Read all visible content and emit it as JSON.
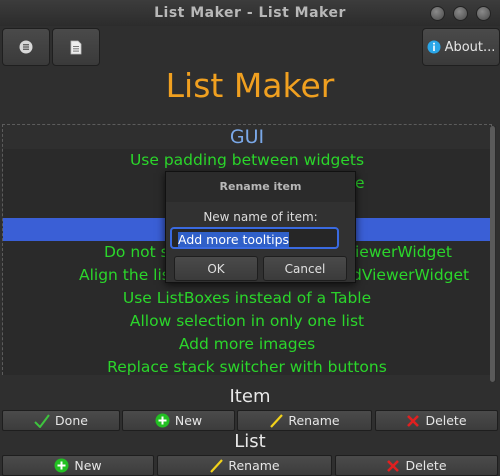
{
  "window": {
    "title": "List Maker - List Maker"
  },
  "toolbar": {
    "about_label": "About..."
  },
  "app_title": "List Maker",
  "list": {
    "header": "GUI",
    "rows": [
      "Use padding between widgets",
      "",
      "",
      "",
      "Do not s",
      "Align the lis",
      "Use ListBoxes instead of a Table",
      "Allow selection in only one list",
      "Add more images",
      "Replace stack switcher with buttons"
    ],
    "row4_right": "iewerWidget",
    "row5_right": "dViewerWidget",
    "row1_right": "e",
    "selected_index": 3
  },
  "dialog": {
    "title": "Rename item",
    "label": "New name of item:",
    "value": "Add more tooltips",
    "ok_label": "OK",
    "cancel_label": "Cancel"
  },
  "item_section": {
    "label": "Item",
    "done_label": "Done",
    "new_label": "New",
    "rename_label": "Rename",
    "delete_label": "Delete"
  },
  "list_section": {
    "label": "List",
    "new_label": "New",
    "rename_label": "Rename",
    "delete_label": "Delete"
  },
  "colors": {
    "accent_orange": "#f0a020",
    "item_green": "#2bd62b",
    "header_blue": "#7aa8e8",
    "selection_blue": "#3a5fd6"
  }
}
